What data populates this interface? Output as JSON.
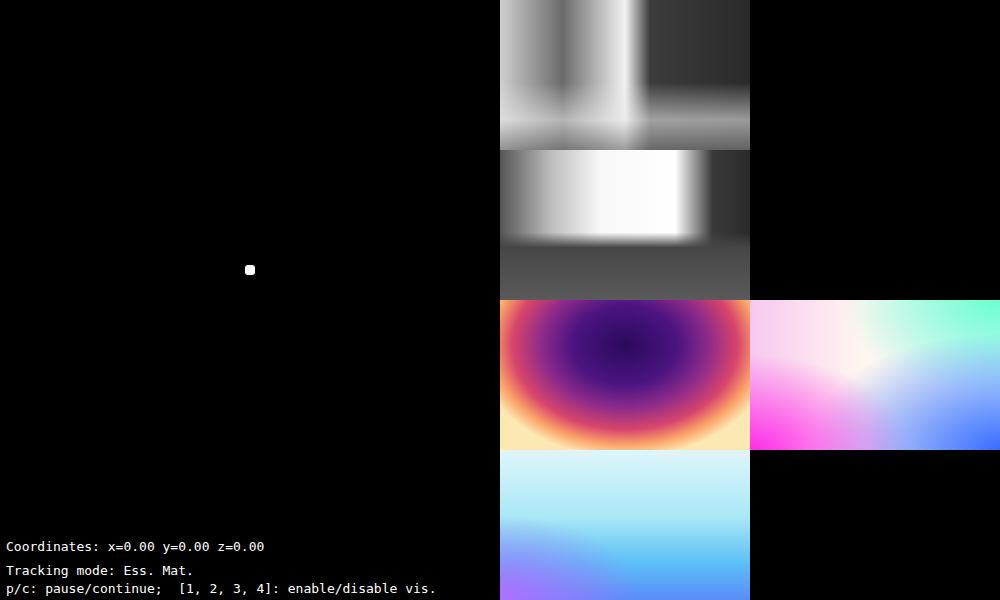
{
  "trajectory_view": {
    "coordinates": "Coordinates: x=0.00 y=0.00 z=0.00",
    "tracking_mode": "Tracking mode: Ess. Mat.",
    "help": "p/c: pause/continue;  [1, 2, 3, 4]: enable/disable vis."
  },
  "panels": [
    {
      "kind": "camera_a"
    },
    {
      "kind": "empty"
    },
    {
      "kind": "camera_b"
    },
    {
      "kind": "empty"
    },
    {
      "kind": "depth"
    },
    {
      "kind": "flow_a"
    },
    {
      "kind": "flow_b"
    },
    {
      "kind": "empty"
    }
  ]
}
